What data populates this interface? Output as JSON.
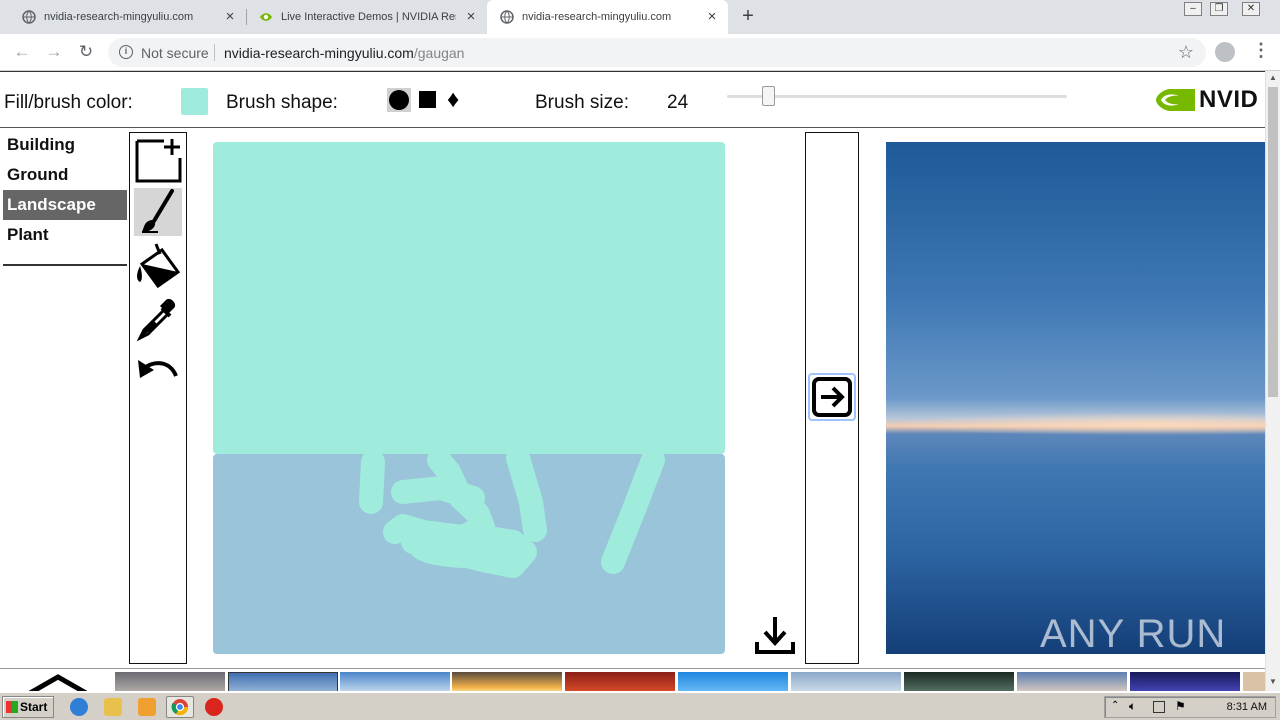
{
  "browser": {
    "tabs": [
      {
        "title": "nvidia-research-mingyuliu.com",
        "active": false
      },
      {
        "title": "Live Interactive Demos | NVIDIA Res",
        "active": false
      },
      {
        "title": "nvidia-research-mingyuliu.com",
        "active": true
      }
    ],
    "security_label": "Not secure",
    "url_host": "nvidia-research-mingyuliu.com",
    "url_path": "/gaugan"
  },
  "controls": {
    "fill_label": "Fill/brush color:",
    "fill_color": "#a0ecdc",
    "shape_label": "Brush shape:",
    "size_label": "Brush size:",
    "brush_size": "24",
    "logo_text": "NVID"
  },
  "labels": {
    "items": [
      {
        "label": "Building",
        "selected": false
      },
      {
        "label": "Ground",
        "selected": false
      },
      {
        "label": "Landscape",
        "selected": true
      },
      {
        "label": "Plant",
        "selected": false
      }
    ]
  },
  "tools": [
    "new-canvas-icon",
    "brush-icon",
    "fill-bucket-icon",
    "eyedropper-icon",
    "undo-icon"
  ],
  "canvas": {
    "sky_color": "#a0ecdc",
    "sea_color": "#9ac4da"
  },
  "watermark": "ANY RUN",
  "taskbar": {
    "start_label": "Start",
    "clock": "8:31 AM"
  }
}
